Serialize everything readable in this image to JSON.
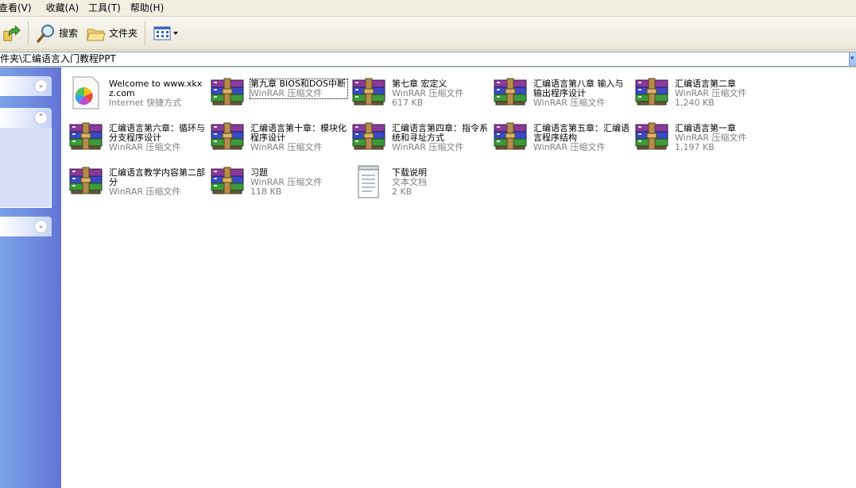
{
  "menu": [
    {
      "label": "查看(V)",
      "name": "menu-view"
    },
    {
      "label": "收藏(A)",
      "name": "menu-favorites"
    },
    {
      "label": "工具(T)",
      "name": "menu-tools"
    },
    {
      "label": "帮助(H)",
      "name": "menu-help"
    }
  ],
  "toolbar": {
    "search_label": "搜索",
    "folders_label": "文件夹"
  },
  "address": {
    "path": "件夹\\汇编语言入门教程PPT"
  },
  "files": [
    {
      "name": "Welcome to www.xkxz.com",
      "type": "Internet 快捷方式",
      "size": "",
      "icon": "internet-shortcut-icon"
    },
    {
      "name": "第九章 BIOS和DOS中断",
      "type": "WinRAR 压缩文件",
      "size": "",
      "icon": "winrar-archive-icon"
    },
    {
      "name": "第七章 宏定义",
      "type": "WinRAR 压缩文件",
      "size": "617 KB",
      "icon": "winrar-archive-icon"
    },
    {
      "name": "汇编语言第八章 输入与输出程序设计",
      "type": "WinRAR 压缩文件",
      "size": "",
      "icon": "winrar-archive-icon"
    },
    {
      "name": "汇编语言第二章",
      "type": "WinRAR 压缩文件",
      "size": "1,240 KB",
      "icon": "winrar-archive-icon"
    },
    {
      "name": "汇编语言第六章：循环与分支程序设计",
      "type": "WinRAR 压缩文件",
      "size": "",
      "icon": "winrar-archive-icon"
    },
    {
      "name": "汇编语言第十章：模块化程序设计",
      "type": "WinRAR 压缩文件",
      "size": "",
      "icon": "winrar-archive-icon"
    },
    {
      "name": "汇编语言第四章：指令系统和寻址方式",
      "type": "WinRAR 压缩文件",
      "size": "",
      "icon": "winrar-archive-icon"
    },
    {
      "name": "汇编语言第五章：汇编语言程序结构",
      "type": "WinRAR 压缩文件",
      "size": "",
      "icon": "winrar-archive-icon"
    },
    {
      "name": "汇编语言第一章",
      "type": "WinRAR 压缩文件",
      "size": "1,197 KB",
      "icon": "winrar-archive-icon"
    },
    {
      "name": "汇编语言教学内容第二部分",
      "type": "WinRAR 压缩文件",
      "size": "",
      "icon": "winrar-archive-icon"
    },
    {
      "name": "习题",
      "type": "WinRAR 压缩文件",
      "size": "118 KB",
      "icon": "winrar-archive-icon"
    },
    {
      "name": "下载说明",
      "type": "文本文档",
      "size": "2 KB",
      "icon": "text-document-icon"
    }
  ]
}
